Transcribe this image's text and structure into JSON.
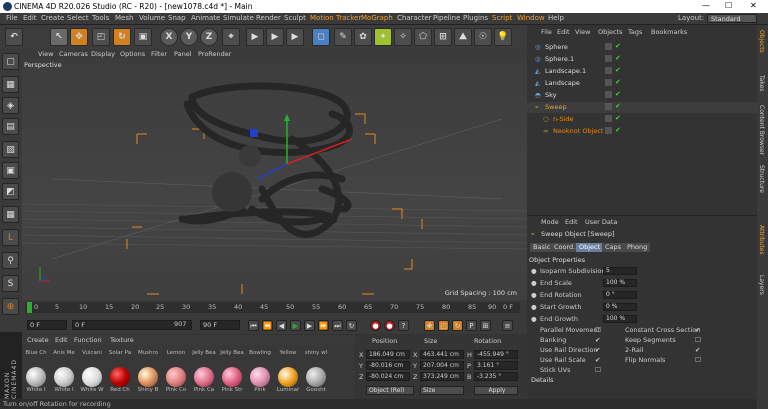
{
  "title_bar": {
    "title": "CINEMA 4D R20.026 Studio (RC - R20) - [new1078.c4d *] - Main",
    "minimize": "—",
    "maximize": "☐",
    "close": "✕"
  },
  "menu": [
    "File",
    "Edit",
    "Create",
    "Select",
    "Tools",
    "Mesh",
    "Volume",
    "Snap",
    "Animate",
    "Simulate",
    "Render",
    "Sculpt",
    "Motion Tracker",
    "MoGraph",
    "Character",
    "Pipeline",
    "Plugins",
    "Script",
    "Window",
    "Help"
  ],
  "layout": {
    "label": "Layout:",
    "value": "Standard"
  },
  "toolbar": [
    "↶",
    "↖",
    "✥",
    "◰",
    "↻",
    "▣",
    "X",
    "Y",
    "Z",
    "⌖",
    "▶",
    "▶",
    "▶",
    "◻",
    "✎",
    "✿",
    "✦",
    "✧",
    "⬠",
    "⊞",
    "⛰",
    "☉",
    "💡"
  ],
  "left_tools": [
    "▢",
    "▦",
    "◈",
    "▤",
    "▧",
    "▣",
    "◩",
    "▦",
    "L",
    "⚲",
    "S",
    "⊕",
    "▦"
  ],
  "viewport_menu": [
    "View",
    "Cameras",
    "Display",
    "Options",
    "Filter",
    "Panel",
    "ProRender"
  ],
  "viewport": {
    "label": "Perspective",
    "grid_spacing": "Grid Spacing : 100 cm"
  },
  "timeline": {
    "ticks": [
      "0",
      "5",
      "10",
      "15",
      "20",
      "25",
      "30",
      "35",
      "40",
      "45",
      "50",
      "55",
      "60",
      "65",
      "70",
      "75",
      "80",
      "85",
      "90"
    ],
    "end": "0 F"
  },
  "playback": {
    "start": "0 F",
    "current": "0 F",
    "min": "907",
    "end": "90 F",
    "end2": "90 F"
  },
  "material_menu": [
    "Create",
    "Edit",
    "Function",
    "Texture"
  ],
  "materials_row1": [
    "Blue Ch",
    "Anis Me",
    "Vulcani",
    "Solar Pa",
    "Mushro",
    "Lemon",
    "Jelly Bea",
    "Jelly Bea",
    "Bowling",
    "Yellow",
    "shiny wl"
  ],
  "materials_row2": [
    "White I",
    "White I",
    "White W",
    "Red Ch",
    "Shiny B",
    "Pink Co",
    "Pink Ca",
    "Pink Str",
    "Pink",
    "Luminar",
    "Goosht"
  ],
  "coordinates": {
    "headers": [
      "Position",
      "Size",
      "Rotation"
    ],
    "rows": [
      {
        "axis": "X",
        "pos": "186.049 cm",
        "size_axis": "X",
        "size": "463.441 cm",
        "rot_axis": "H",
        "rot": "-455.949 °"
      },
      {
        "axis": "Y",
        "pos": "-80.016 cm",
        "size_axis": "Y",
        "size": "207.004 cm",
        "rot_axis": "P",
        "rot": "3.161 °"
      },
      {
        "axis": "Z",
        "pos": "-80.024 cm",
        "size_axis": "Z",
        "size": "373.249 cm",
        "rot_axis": "B",
        "rot": "-3.235 °"
      }
    ],
    "mode": "Object (Rel)",
    "size_mode": "Size",
    "apply": "Apply"
  },
  "object_manager": {
    "menu": [
      "File",
      "Edit",
      "View",
      "Objects",
      "Tags",
      "Bookmarks"
    ],
    "objects": [
      {
        "name": "Sphere"
      },
      {
        "name": "Sphere.1"
      },
      {
        "name": "Landscape.1"
      },
      {
        "name": "Landscape"
      },
      {
        "name": "Sky"
      },
      {
        "name": "Sweep"
      },
      {
        "name": "n-Side"
      },
      {
        "name": "Neoknot Object"
      }
    ]
  },
  "attributes": {
    "menu": [
      "Mode",
      "Edit",
      "User Data"
    ],
    "title": "Sweep Object [Sweep]",
    "tabs": [
      "Basic",
      "Coord.",
      "Object",
      "Caps",
      "Phong"
    ],
    "section": "Object Properties",
    "props": [
      {
        "label": "Isoparm Subdivision",
        "value": "5"
      },
      {
        "label": "End Scale",
        "value": "100 %"
      },
      {
        "label": "End Rotation",
        "value": "0 °"
      },
      {
        "label": "Start Growth",
        "value": "0 %"
      },
      {
        "label": "End Growth",
        "value": "100 %"
      }
    ],
    "checks_left": [
      {
        "label": "Parallel Movement",
        "value": "☐"
      },
      {
        "label": "Banking",
        "value": "✔"
      },
      {
        "label": "Use Rail Direction",
        "value": "✔"
      },
      {
        "label": "Use Rail Scale",
        "value": "✔"
      },
      {
        "label": "Stick UVs",
        "value": "☐"
      }
    ],
    "checks_right": [
      {
        "label": "Constant Cross Section",
        "value": "✔"
      },
      {
        "label": "Keep Segments",
        "value": "☐"
      },
      {
        "label": "2-Rail",
        "value": "✔"
      },
      {
        "label": "Flip Normals",
        "value": "☐"
      }
    ],
    "details": "Details"
  },
  "side_tabs": [
    "Objects",
    "Takes",
    "Content Browser",
    "Structure",
    "Attributes",
    "Layers"
  ],
  "status": "Turn on/off Rotation for recording"
}
